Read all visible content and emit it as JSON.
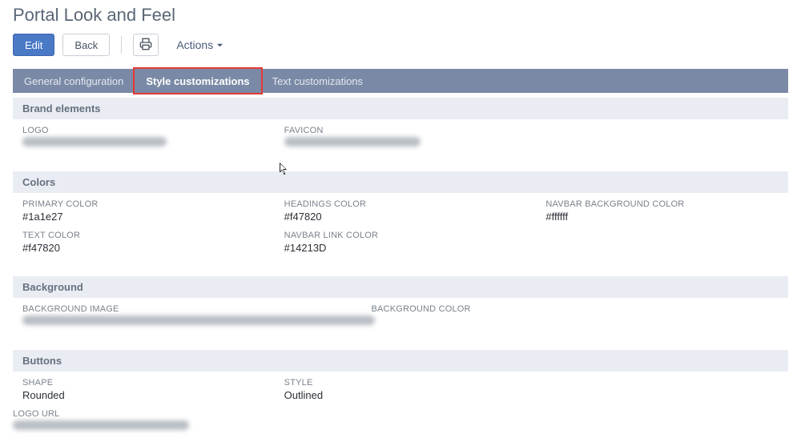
{
  "page": {
    "title": "Portal Look and Feel"
  },
  "toolbar": {
    "edit": "Edit",
    "back": "Back",
    "actions": "Actions"
  },
  "tabs": {
    "general": "General configuration",
    "style": "Style customizations",
    "text": "Text customizations"
  },
  "sections": {
    "brand": {
      "title": "Brand elements",
      "logo_label": "LOGO",
      "favicon_label": "FAVICON"
    },
    "colors": {
      "title": "Colors",
      "primary_label": "PRIMARY COLOR",
      "primary_value": "#1a1e27",
      "headings_label": "HEADINGS COLOR",
      "headings_value": "#f47820",
      "navbarbg_label": "NAVBAR BACKGROUND COLOR",
      "navbarbg_value": "#ffffff",
      "text_label": "TEXT COLOR",
      "text_value": "#f47820",
      "navbarlink_label": "NAVBAR LINK COLOR",
      "navbarlink_value": "#14213D"
    },
    "background": {
      "title": "Background",
      "bgimage_label": "BACKGROUND IMAGE",
      "bgcolor_label": "BACKGROUND COLOR"
    },
    "buttons": {
      "title": "Buttons",
      "shape_label": "SHAPE",
      "shape_value": "Rounded",
      "style_label": "STYLE",
      "style_value": "Outlined",
      "logourl_label": "LOGO URL"
    }
  }
}
